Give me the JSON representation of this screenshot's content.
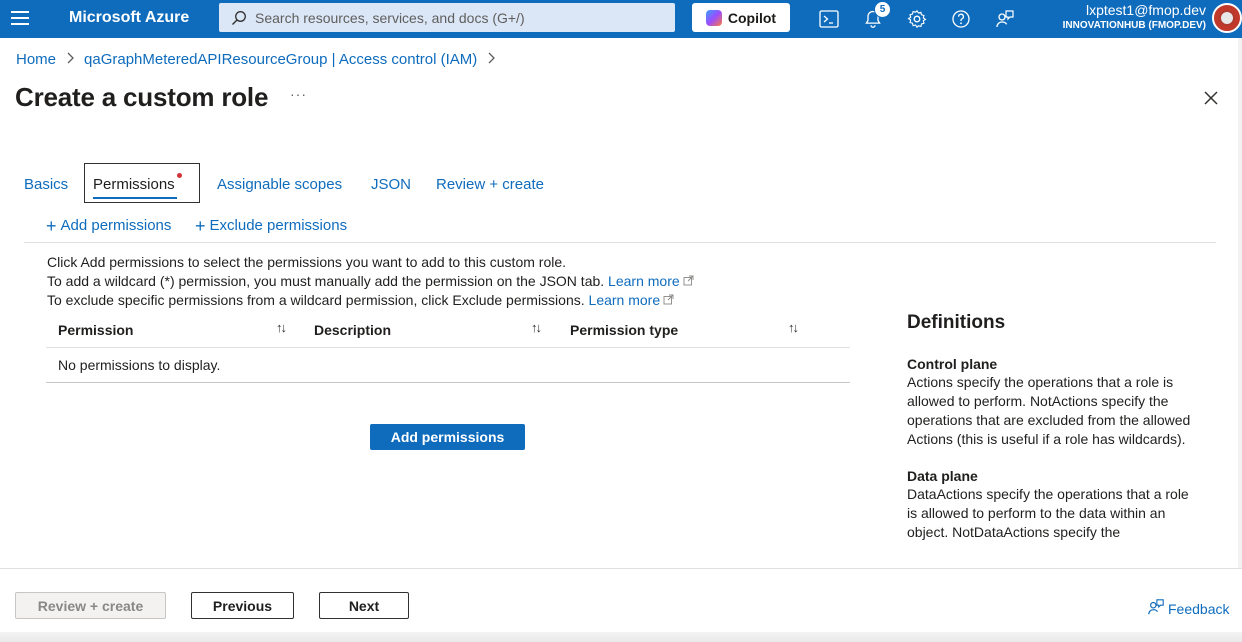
{
  "topbar": {
    "brand": "Microsoft Azure",
    "search_placeholder": "Search resources, services, and docs (G+/)",
    "copilot_label": "Copilot",
    "notification_count": "5",
    "account_email": "lxptest1@fmop.dev",
    "account_tenant": "INNOVATIONHUB (FMOP.DEV)",
    "icons": [
      "hamburger-icon",
      "search-icon",
      "copilot-icon",
      "cloud-shell-icon",
      "notifications-icon",
      "settings-icon",
      "help-icon",
      "feedback-icon"
    ]
  },
  "breadcrumb": {
    "items": [
      "Home",
      "qaGraphMeteredAPIResourceGroup | Access control (IAM)"
    ],
    "separator": ">"
  },
  "page": {
    "title": "Create a custom role",
    "more": "···"
  },
  "tabs": [
    {
      "label": "Basics"
    },
    {
      "label": "Permissions",
      "selected": true,
      "has_required_indicator": true
    },
    {
      "label": "Assignable scopes"
    },
    {
      "label": "JSON"
    },
    {
      "label": "Review + create"
    }
  ],
  "commands": {
    "add_permissions": "Add permissions",
    "exclude_permissions": "Exclude permissions"
  },
  "info": {
    "line1": "Click Add permissions to select the permissions you want to add to this custom role.",
    "line2": "To add a wildcard (*) permission, you must manually add the permission on the JSON tab.",
    "line3": "To exclude specific permissions from a wildcard permission, click Exclude permissions.",
    "learn_more": "Learn more"
  },
  "table": {
    "columns": [
      "Permission",
      "Description",
      "Permission type"
    ],
    "sort_glyph": "↑↓",
    "empty_text": "No permissions to display."
  },
  "primary_button": "Add permissions",
  "definitions": {
    "title": "Definitions",
    "control_plane_title": "Control plane",
    "control_plane_text": "Actions specify the operations that a role is allowed to perform. NotActions specify the operations that are excluded from the allowed Actions (this is useful if a role has wildcards).",
    "data_plane_title": "Data plane",
    "data_plane_text": "DataActions specify the operations that a role is allowed to perform to the data within an object. NotDataActions specify the"
  },
  "footer": {
    "review_create": "Review + create",
    "previous": "Previous",
    "next": "Next",
    "feedback": "Feedback"
  },
  "colors": {
    "azure_blue": "#0f6cbd",
    "required_dot": "#d13438",
    "text": "#201f1e"
  }
}
